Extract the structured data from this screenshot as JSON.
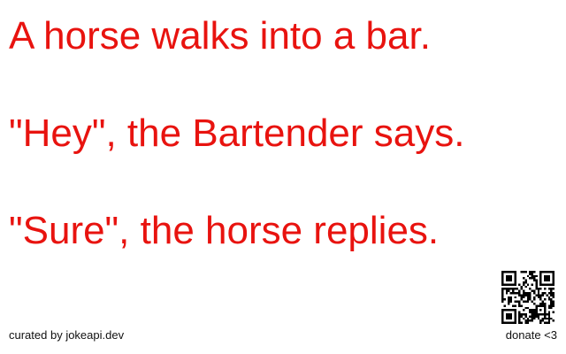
{
  "joke": {
    "lines": [
      "A horse walks into a bar.",
      "\"Hey\", the Bartender says.",
      "\"Sure\", the horse replies."
    ]
  },
  "footer": {
    "credit": "curated by jokeapi.dev",
    "donate": "donate <3"
  },
  "colors": {
    "joke_text": "#e8130f",
    "footer_text": "#111111",
    "background": "#ffffff"
  },
  "icons": {
    "donate_qr": "qr-code"
  }
}
